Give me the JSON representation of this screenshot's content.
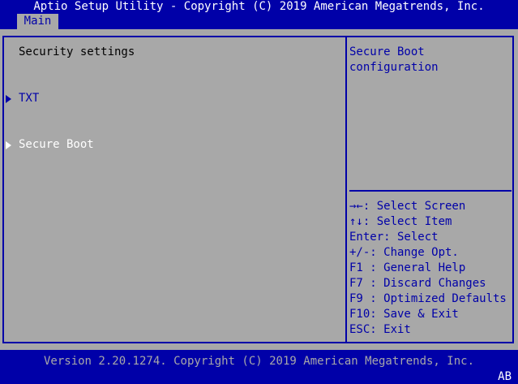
{
  "title": "Aptio Setup Utility - Copyright (C) 2019 American Megatrends, Inc.",
  "tabs": [
    {
      "label": "Main",
      "selected": true
    }
  ],
  "main": {
    "heading": "Security settings",
    "items": [
      {
        "label": "TXT",
        "selected": false,
        "icon": "submenu-arrow"
      },
      {
        "label": "Secure Boot",
        "selected": true,
        "icon": "submenu-arrow"
      }
    ]
  },
  "help": {
    "description": "Secure Boot\nconfiguration",
    "keys": [
      "→←: Select Screen",
      "↑↓: Select Item",
      "Enter: Select",
      "+/-: Change Opt.",
      "F1 : General Help",
      "F7 : Discard Changes",
      "F9 : Optimized Defaults",
      "F10: Save & Exit",
      "ESC: Exit"
    ]
  },
  "footer": "Version 2.20.1274. Copyright (C) 2019 American Megatrends, Inc.",
  "corner": "AB",
  "colors": {
    "background": "#0000a8",
    "panel": "#a8a8a8",
    "highlight": "#ffffff"
  }
}
